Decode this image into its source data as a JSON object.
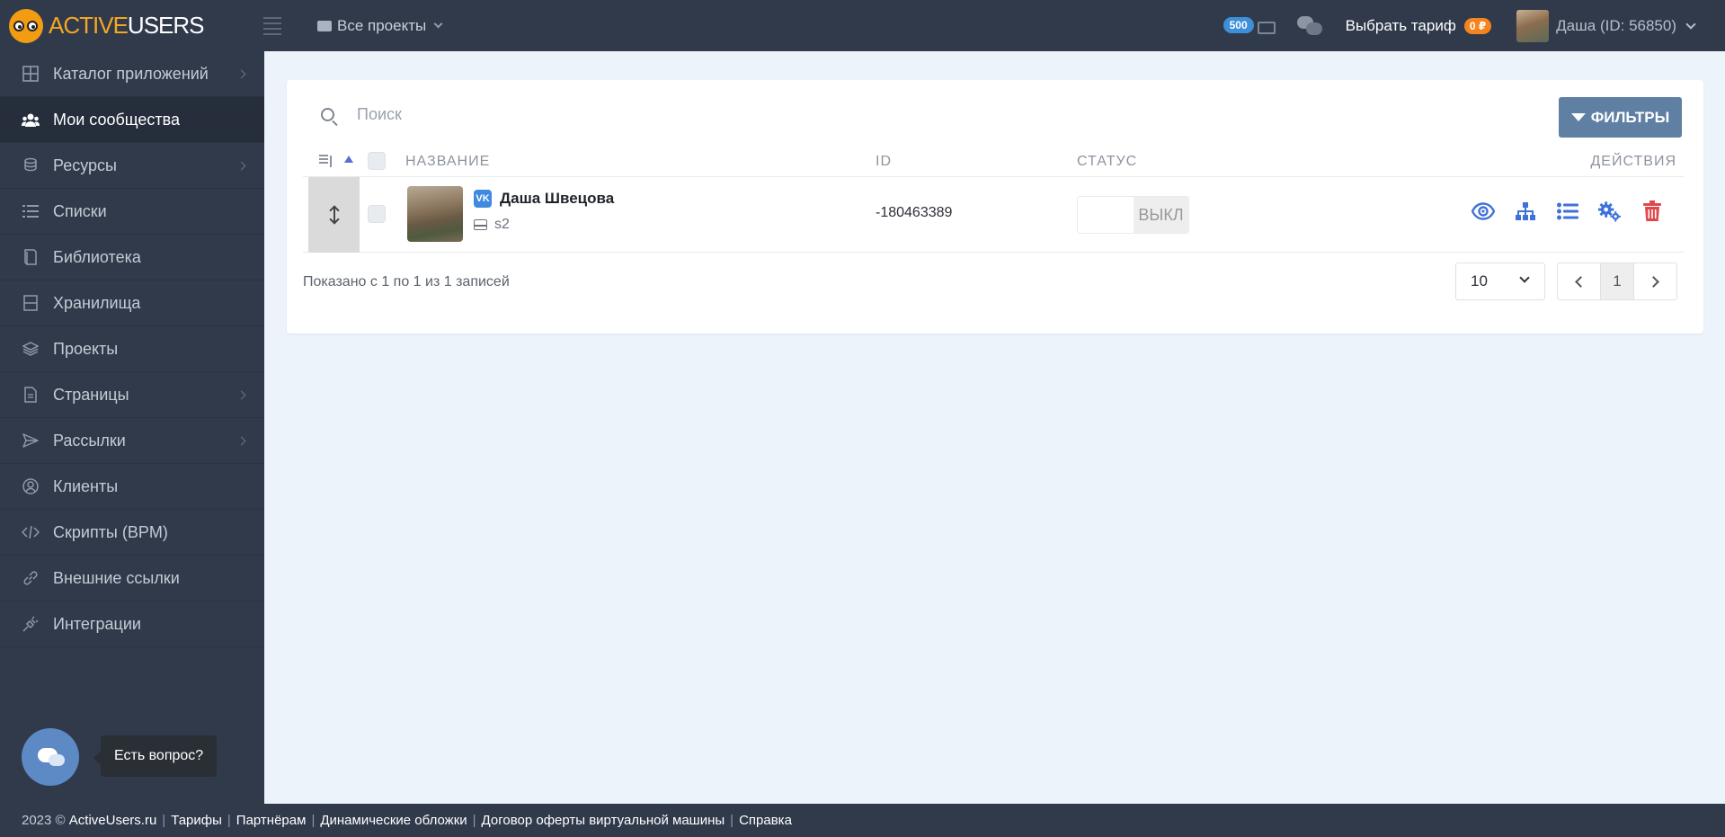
{
  "brand": {
    "part1": "ACTIVE",
    "part2": "USERS"
  },
  "header": {
    "projects_label": "Все проекты",
    "credits": "500",
    "tariff_label": "Выбрать тариф",
    "balance": "0 ₽",
    "user_label": "Даша (ID: 56850)"
  },
  "sidebar": {
    "items": [
      {
        "label": "Каталог приложений",
        "icon": "grid-icon",
        "has_submenu": true
      },
      {
        "label": "Мои сообщества",
        "icon": "users-icon",
        "active": true
      },
      {
        "label": "Ресурсы",
        "icon": "coins-icon",
        "has_submenu": true
      },
      {
        "label": "Списки",
        "icon": "list-icon"
      },
      {
        "label": "Библиотека",
        "icon": "book-icon"
      },
      {
        "label": "Хранилища",
        "icon": "storage-icon"
      },
      {
        "label": "Проекты",
        "icon": "layers-icon"
      },
      {
        "label": "Страницы",
        "icon": "file-icon",
        "has_submenu": true
      },
      {
        "label": "Рассылки",
        "icon": "send-icon",
        "has_submenu": true
      },
      {
        "label": "Клиенты",
        "icon": "user-circle-icon"
      },
      {
        "label": "Скрипты (BPM)",
        "icon": "code-icon"
      },
      {
        "label": "Внешние ссылки",
        "icon": "link-icon"
      },
      {
        "label": "Интеграции",
        "icon": "plug-icon"
      }
    ]
  },
  "help": {
    "label": "Есть вопрос?"
  },
  "main": {
    "search_placeholder": "Поиск",
    "filters_label": "ФИЛЬТРЫ",
    "columns": {
      "name": "НАЗВАНИЕ",
      "id": "ID",
      "status": "СТАТУС",
      "actions": "ДЕЙСТВИЯ"
    },
    "rows": [
      {
        "name": "Даша Швецова",
        "network": "VK",
        "storage": "s2",
        "id": "-180463389",
        "status": "ВЫКЛ"
      }
    ],
    "shown_text": "Показано с 1 по 1 из 1 записей",
    "per_page": "10",
    "current_page": "1"
  },
  "colors": {
    "accent": "#5f7fa3",
    "action_blue": "#3f72d9",
    "danger": "#e0484b",
    "badge_orange": "#f5841f"
  },
  "footer": {
    "copyright": "2023 ©",
    "links": [
      "ActiveUsers.ru",
      "Тарифы",
      "Партнёрам",
      "Динамические обложки",
      "Договор оферты виртуальной машины",
      "Справка"
    ]
  }
}
